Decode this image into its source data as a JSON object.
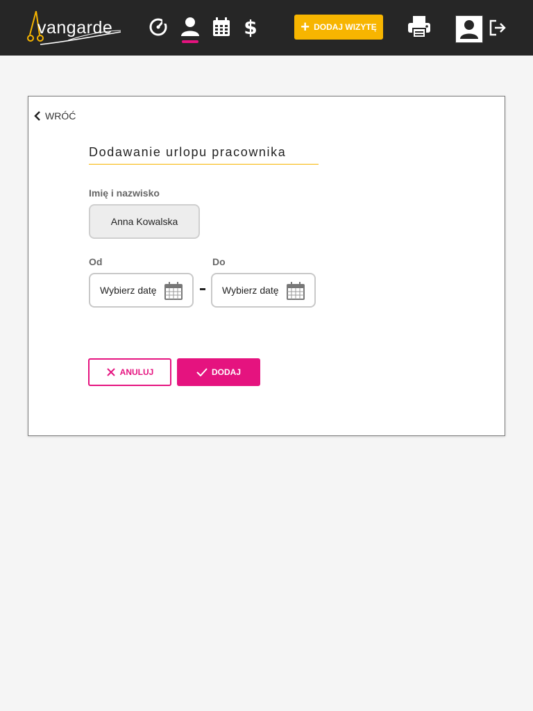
{
  "colors": {
    "header_bg": "#262626",
    "brand_yellow": "#f7b500",
    "accent_pink": "#e5137f",
    "page_bg": "#f5f5f5"
  },
  "header": {
    "logo_text": "vangarde",
    "nav": [
      {
        "icon": "dashboard-gauge-icon"
      },
      {
        "icon": "user-icon",
        "active": true
      },
      {
        "icon": "calendar-icon"
      },
      {
        "icon": "dollar-icon"
      }
    ],
    "add_visit_label": "DODAJ WIZYTĘ",
    "print_icon": "printer-icon",
    "profile_icon": "profile-icon",
    "logout_icon": "logout-icon"
  },
  "card": {
    "back_label": "WRÓĆ",
    "title": "Dodawanie urlopu pracownika",
    "name_label": "Imię i nazwisko",
    "name_value": "Anna Kowalska",
    "from_label": "Od",
    "to_label": "Do",
    "from_placeholder": "Wybierz datę",
    "to_placeholder": "Wybierz datę",
    "cancel_label": "ANULUJ",
    "add_label": "DODAJ"
  }
}
